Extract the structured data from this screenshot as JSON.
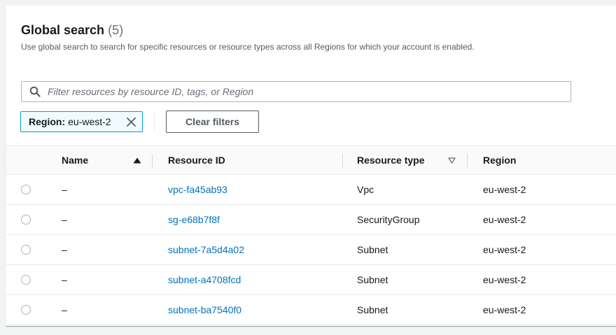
{
  "header": {
    "title": "Global search",
    "count": "(5)",
    "description": "Use global search to search for specific resources or resource types across all Regions for which your account is enabled."
  },
  "search": {
    "placeholder": "Filter resources by resource ID, tags, or Region",
    "value": ""
  },
  "filter_token": {
    "key": "Region:",
    "value": "eu-west-2"
  },
  "clear_filters_label": "Clear filters",
  "columns": {
    "name": "Name",
    "resource_id": "Resource ID",
    "resource_type": "Resource type",
    "region": "Region"
  },
  "rows": [
    {
      "name": "–",
      "resource_id": "vpc-fa45ab93",
      "resource_type": "Vpc",
      "region": "eu-west-2"
    },
    {
      "name": "–",
      "resource_id": "sg-e68b7f8f",
      "resource_type": "SecurityGroup",
      "region": "eu-west-2"
    },
    {
      "name": "–",
      "resource_id": "subnet-7a5d4a02",
      "resource_type": "Subnet",
      "region": "eu-west-2"
    },
    {
      "name": "–",
      "resource_id": "subnet-a4708fcd",
      "resource_type": "Subnet",
      "region": "eu-west-2"
    },
    {
      "name": "–",
      "resource_id": "subnet-ba7540f0",
      "resource_type": "Subnet",
      "region": "eu-west-2"
    }
  ],
  "colors": {
    "link": "#0073bb",
    "token_border": "#00a1c9",
    "token_background": "#f1faff"
  },
  "icons": {
    "search": "search-icon",
    "dismiss": "close-icon",
    "sort_ascending": "caret-up-filled-icon",
    "sort_unsorted": "caret-down-outline-icon"
  }
}
